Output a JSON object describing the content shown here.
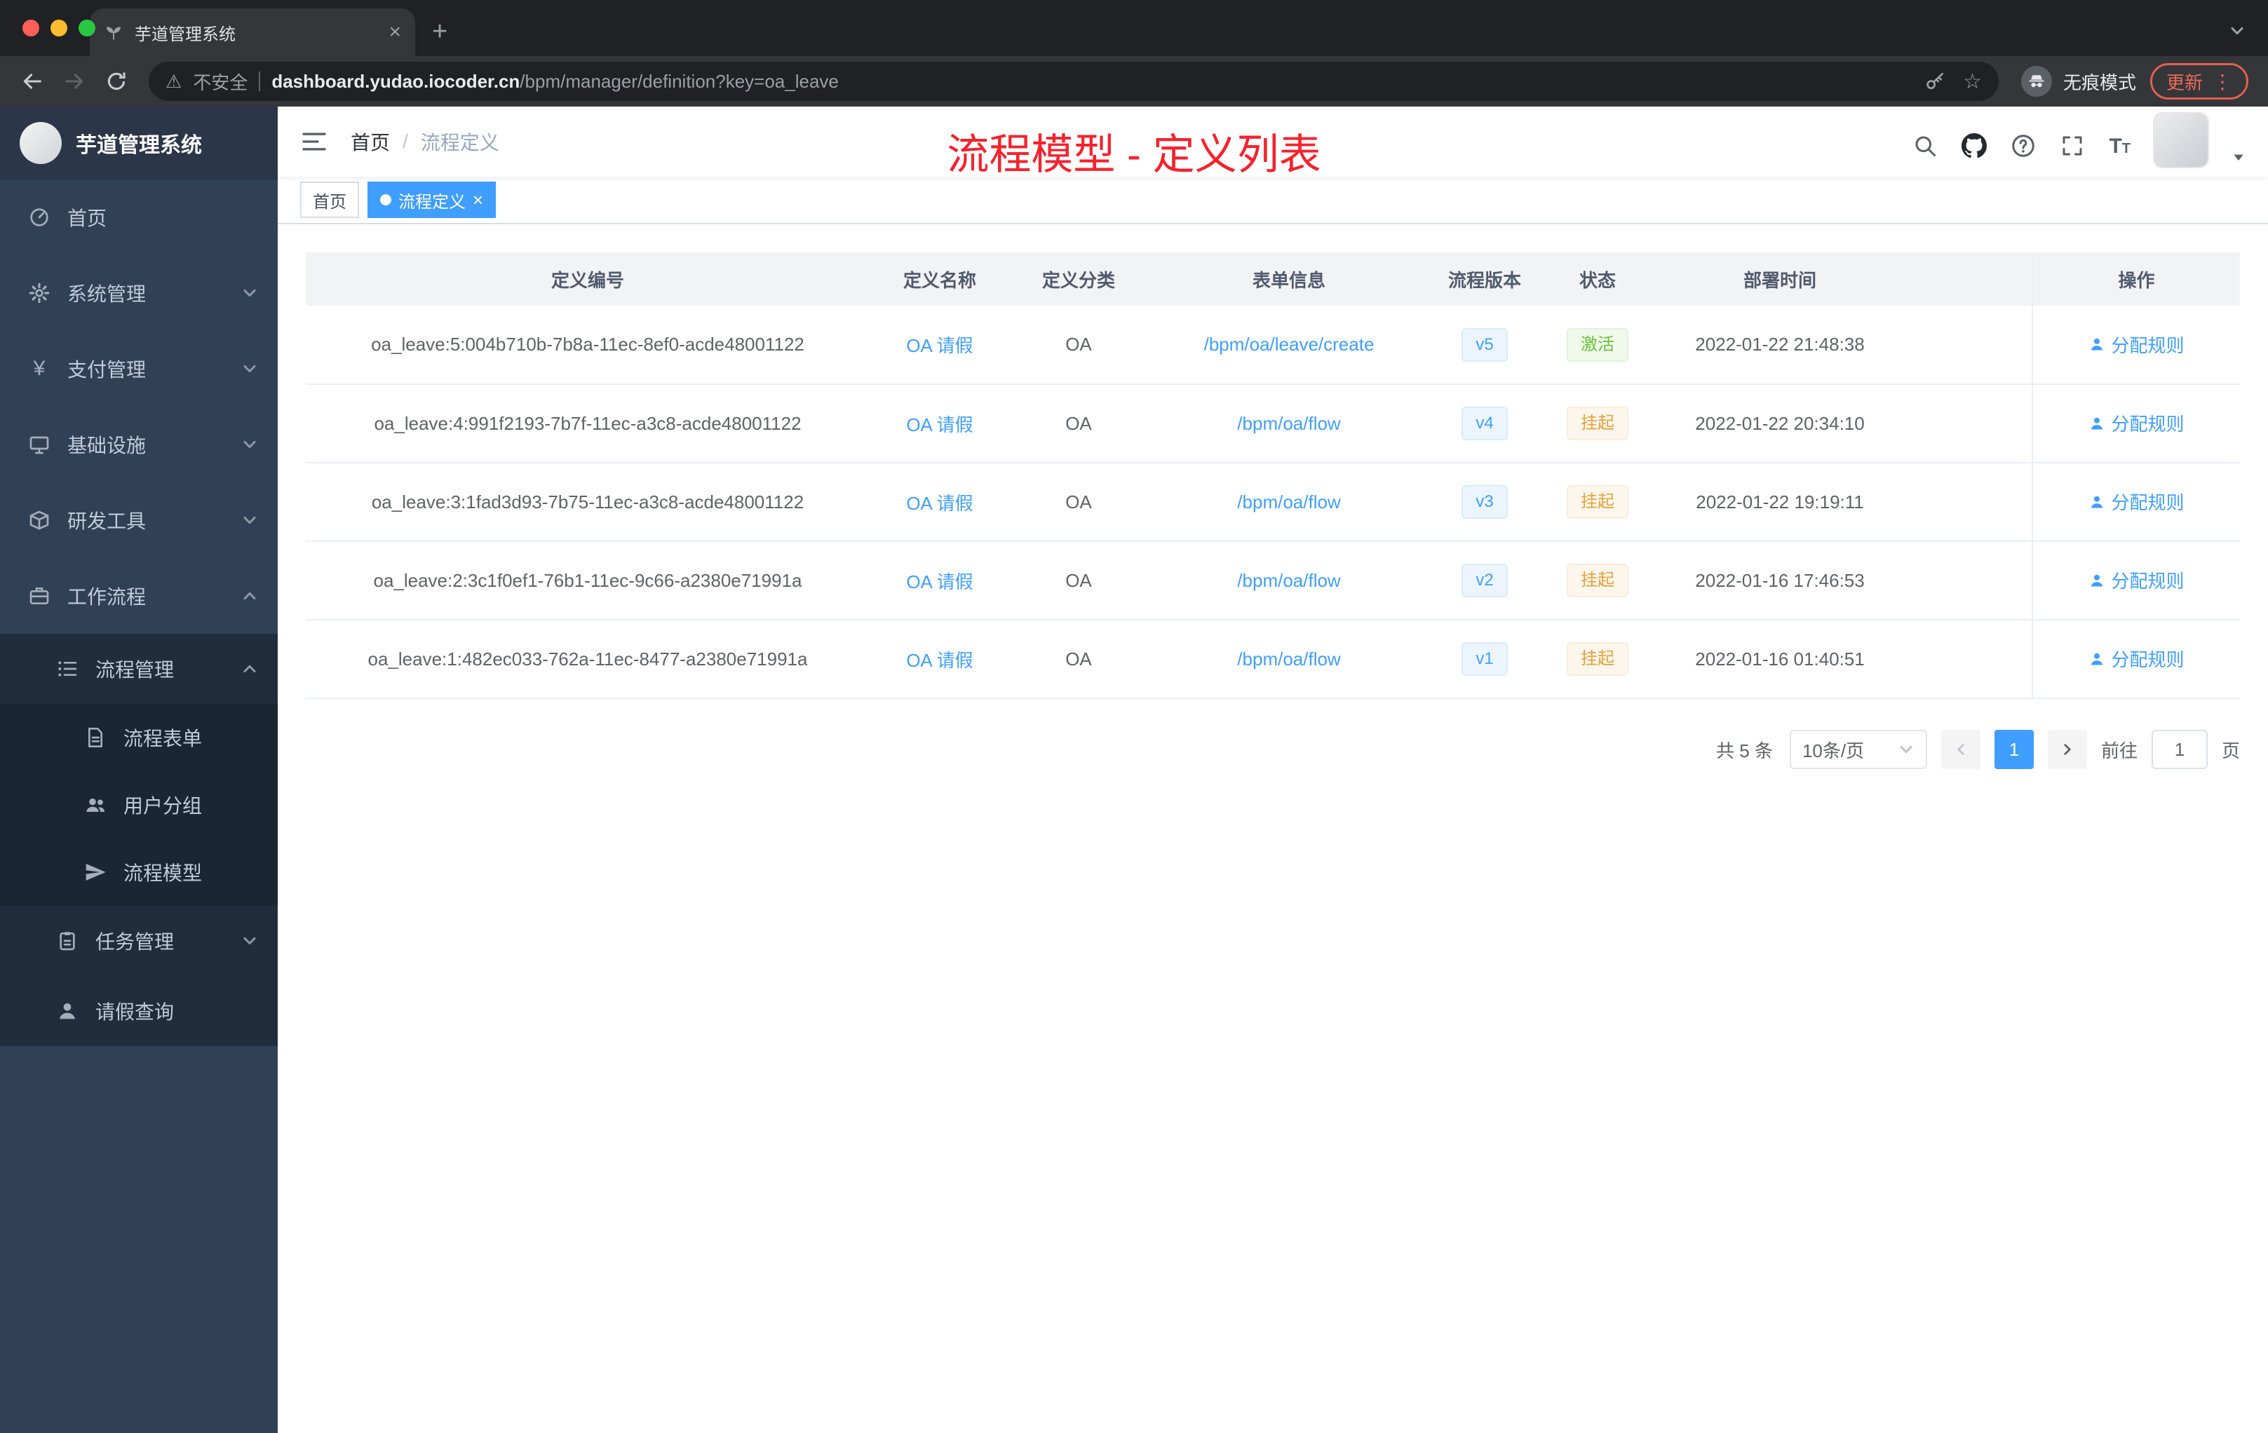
{
  "colors": {
    "accent": "#409eff",
    "success": "#67c23a",
    "warning": "#e6a23c",
    "annotation_red": "#f5222d",
    "sidebar_bg": "#304156",
    "sidebar_sub_bg": "#1f2d3d"
  },
  "glyphs": {
    "yen": "¥",
    "close": "×",
    "plus": "+",
    "kebab": "⋮",
    "star": "☆",
    "warning": "⚠",
    "font_size": "T"
  },
  "browser": {
    "tab_title": "芋道管理系统",
    "address": {
      "security_label": "不安全",
      "host": "dashboard.yudao.iocoder.cn",
      "path": "/bpm/manager/definition?key=oa_leave"
    },
    "incognito_label": "无痕模式",
    "update_label": "更新"
  },
  "sidebar": {
    "brand": "芋道管理系统",
    "menu": [
      {
        "label": "首页",
        "icon": "dashboard-icon"
      },
      {
        "label": "系统管理",
        "icon": "gear-icon",
        "expandable": true
      },
      {
        "label": "支付管理",
        "icon": "yen-icon",
        "expandable": true
      },
      {
        "label": "基础设施",
        "icon": "monitor-icon",
        "expandable": true
      },
      {
        "label": "研发工具",
        "icon": "toolbox-icon",
        "expandable": true
      },
      {
        "label": "工作流程",
        "icon": "briefcase-icon",
        "expanded": true,
        "children": [
          {
            "label": "流程管理",
            "icon": "list-icon",
            "expanded": true,
            "children": [
              {
                "label": "流程表单",
                "icon": "form-icon"
              },
              {
                "label": "用户分组",
                "icon": "user-group-icon"
              },
              {
                "label": "流程模型",
                "icon": "paper-plane-icon"
              }
            ]
          },
          {
            "label": "任务管理",
            "icon": "clipboard-icon",
            "expandable": true
          },
          {
            "label": "请假查询",
            "icon": "user-icon"
          }
        ]
      }
    ]
  },
  "navbar": {
    "breadcrumb": {
      "home": "首页",
      "separator": "/",
      "current": "流程定义"
    },
    "right_icons": [
      "search-icon",
      "github-icon",
      "question-icon",
      "fullscreen-icon",
      "font-size-icon",
      "avatar",
      "caret-down-icon"
    ]
  },
  "annotation": {
    "text": "流程模型 - 定义列表"
  },
  "tags": [
    {
      "label": "首页",
      "active": false
    },
    {
      "label": "流程定义",
      "active": true
    }
  ],
  "table": {
    "columns": [
      "定义编号",
      "定义名称",
      "定义分类",
      "表单信息",
      "流程版本",
      "状态",
      "部署时间",
      "操作"
    ],
    "rows": [
      {
        "id": "oa_leave:5:004b710b-7b8a-11ec-8ef0-acde48001122",
        "name": "OA 请假",
        "category": "OA",
        "form": "/bpm/oa/leave/create",
        "version": "v5",
        "status": "激活",
        "time": "2022-01-22 21:48:38",
        "action": "分配规则"
      },
      {
        "id": "oa_leave:4:991f2193-7b7f-11ec-a3c8-acde48001122",
        "name": "OA 请假",
        "category": "OA",
        "form": "/bpm/oa/flow",
        "version": "v4",
        "status": "挂起",
        "time": "2022-01-22 20:34:10",
        "action": "分配规则"
      },
      {
        "id": "oa_leave:3:1fad3d93-7b75-11ec-a3c8-acde48001122",
        "name": "OA 请假",
        "category": "OA",
        "form": "/bpm/oa/flow",
        "version": "v3",
        "status": "挂起",
        "time": "2022-01-22 19:19:11",
        "action": "分配规则"
      },
      {
        "id": "oa_leave:2:3c1f0ef1-76b1-11ec-9c66-a2380e71991a",
        "name": "OA 请假",
        "category": "OA",
        "form": "/bpm/oa/flow",
        "version": "v2",
        "status": "挂起",
        "time": "2022-01-16 17:46:53",
        "action": "分配规则"
      },
      {
        "id": "oa_leave:1:482ec033-762a-11ec-8477-a2380e71991a",
        "name": "OA 请假",
        "category": "OA",
        "form": "/bpm/oa/flow",
        "version": "v1",
        "status": "挂起",
        "time": "2022-01-16 01:40:51",
        "action": "分配规则"
      }
    ]
  },
  "pagination": {
    "total": "共 5 条",
    "page_size": "10条/页",
    "current": "1",
    "goto_label": "前往",
    "goto_value": "1",
    "page_unit": "页"
  }
}
